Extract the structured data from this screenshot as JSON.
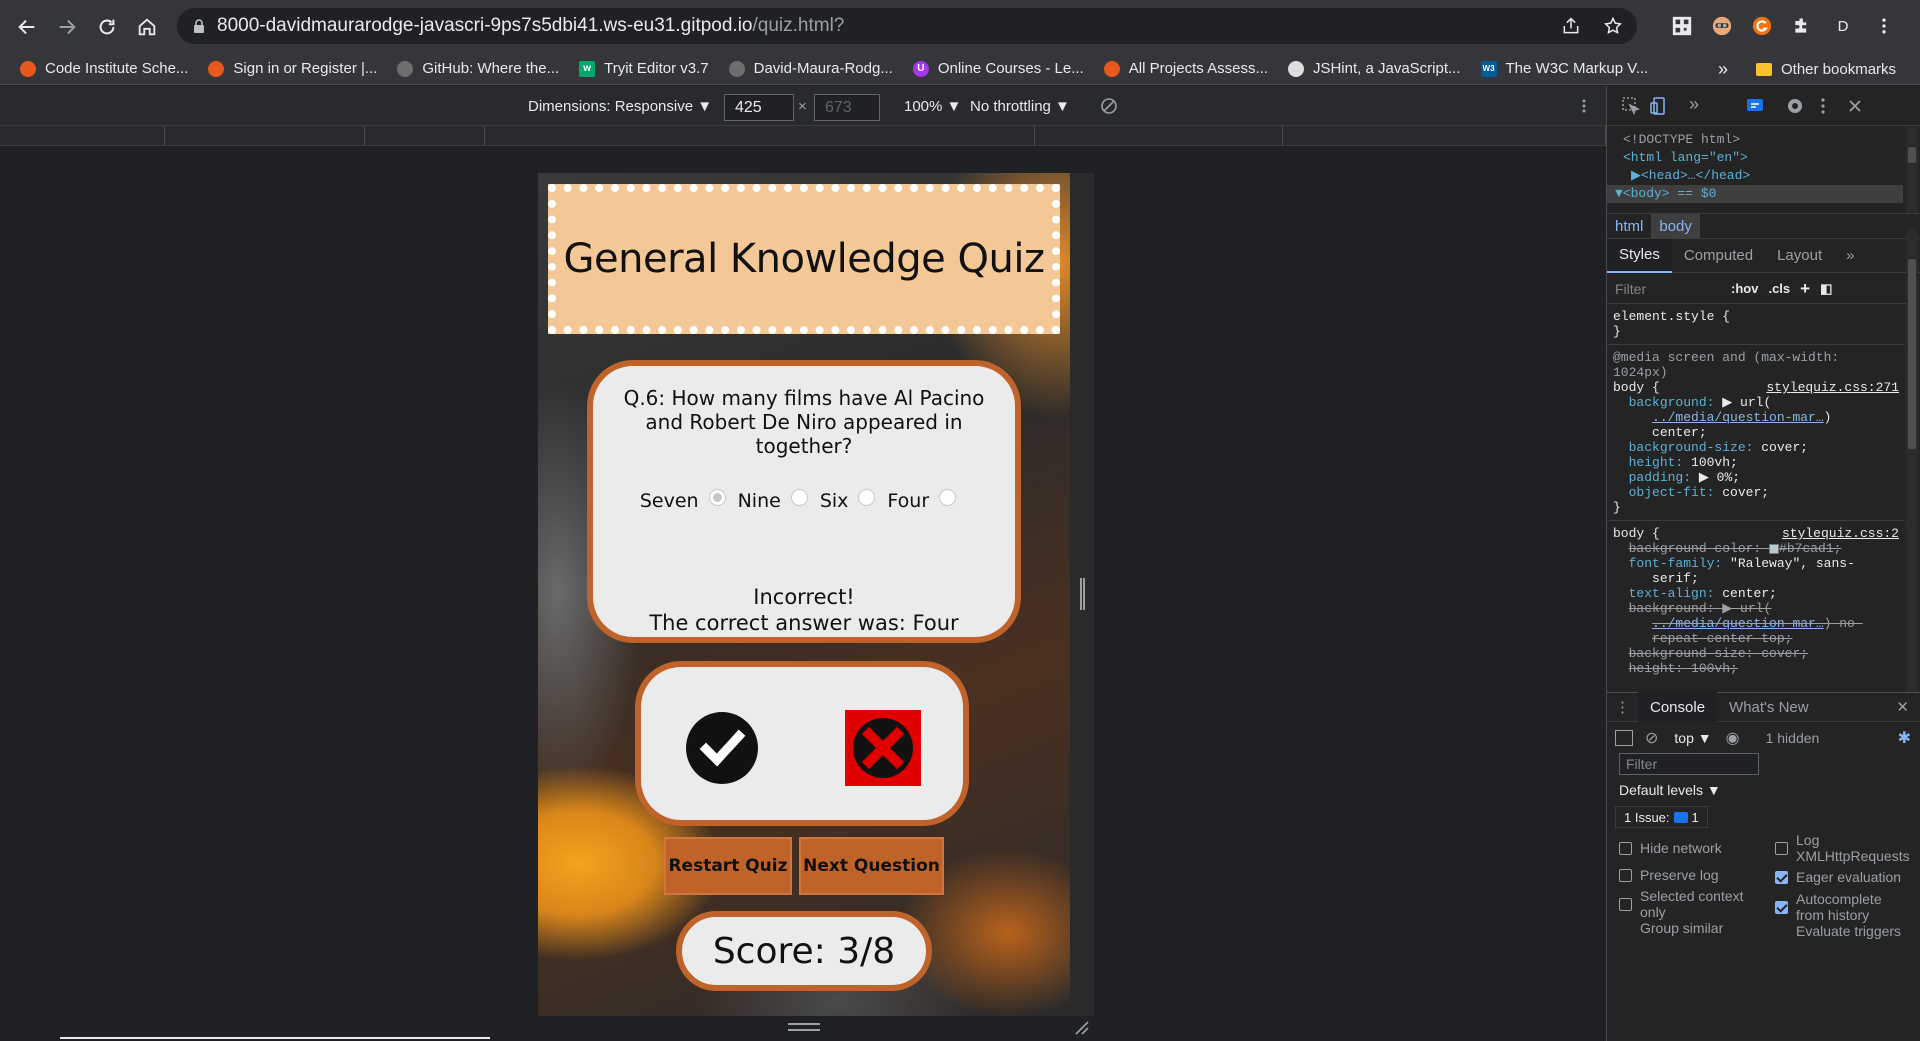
{
  "browser": {
    "url_host": "8000-davidmaurarodge-javascri-9ps7s5dbi41.ws-eu31.gitpod.io",
    "url_path": "/quiz.html?",
    "profile_initial": "D",
    "bookmarks": [
      {
        "label": "Code Institute Sche...",
        "color": "#e8581e",
        "glyph": ""
      },
      {
        "label": "Sign in or Register |...",
        "color": "#e8581e",
        "glyph": ""
      },
      {
        "label": "GitHub: Where the...",
        "color": "#555555",
        "glyph": ""
      },
      {
        "label": "Tryit Editor v3.7",
        "color": "#04aa6d",
        "glyph": "w"
      },
      {
        "label": "David-Maura-Rodg...",
        "color": "#555555",
        "glyph": ""
      },
      {
        "label": "Online Courses - Le...",
        "color": "#a435f0",
        "glyph": "U"
      },
      {
        "label": "All Projects Assess...",
        "color": "#e8581e",
        "glyph": ""
      },
      {
        "label": "JSHint, a JavaScript...",
        "color": "#dddddd",
        "glyph": ""
      },
      {
        "label": "The W3C Markup V...",
        "color": "#005a9c",
        "glyph": "W3"
      }
    ],
    "bookmarks_more": "»",
    "other_bookmarks": "Other bookmarks"
  },
  "device_toolbar": {
    "dimensions": "Dimensions: Responsive ▼",
    "width": "425",
    "times": "×",
    "height": "673",
    "zoom": "100% ▼",
    "throttling": "No throttling ▼"
  },
  "quiz": {
    "title": "General Knowledge Quiz",
    "question": "Q.6: How many films have Al Pacino and Robert De Niro appeared in together?",
    "answers": [
      {
        "label": "Seven",
        "checked": true
      },
      {
        "label": "Nine",
        "checked": false
      },
      {
        "label": "Six",
        "checked": false
      },
      {
        "label": "Four",
        "checked": false
      }
    ],
    "feedback_line1": "Incorrect!",
    "feedback_line2": "The correct answer was: Four",
    "restart_label": "Restart Quiz",
    "next_label": "Next Question",
    "score": "Score: 3/8"
  },
  "devtools": {
    "dom": {
      "doctype": "<!DOCTYPE html>",
      "html_open": "<html lang=\"en\">",
      "head": "▶<head>…</head>",
      "body": "▼<body> == $0"
    },
    "breadcrumbs": [
      "html",
      "body"
    ],
    "tabs": [
      "Styles",
      "Computed",
      "Layout",
      "»"
    ],
    "filter_placeholder": "Filter",
    "hov": ":hov",
    "cls": ".cls",
    "css_rules": {
      "element_style": "element.style {",
      "close": "}",
      "media": "@media screen and (max-width:",
      "media2": "1024px)",
      "body_sel": "body {",
      "link1": "stylequiz.css:271",
      "link2": "stylequiz.css:2",
      "bg": "background:",
      "bg_val": "▶ url(",
      "bg_url": "../media/question-mar…",
      "bg_end": ")",
      "center": "center;",
      "bgsize": "background-size:",
      "bgsize_val": "cover;",
      "height": "height:",
      "height_val": "100vh;",
      "padding": "padding:",
      "padding_val": "▶ 0%;",
      "objfit": "object-fit:",
      "objfit_val": "cover;",
      "bgcolor": "background-color:",
      "bgcolor_val": "#b7cad1;",
      "font": "font-family:",
      "font_val": "\"Raleway\", sans-",
      "font_val2": "serif;",
      "textalign": "text-align:",
      "textalign_val": "center;",
      "bg2": "background:",
      "bg2_val": "▶ url(",
      "bg2_url": "../media/question-mar…",
      "bg2_end": ") no-",
      "bg2_rest": "repeat center top;",
      "bgsize2": "background-size:",
      "bgsize2_val": "cover;",
      "height2": "height:",
      "height2_val": "100vh;"
    },
    "drawer_tabs": [
      "Console",
      "What's New"
    ],
    "console_context": "top ▼",
    "hidden_count": "1 hidden",
    "console_filter": "Filter",
    "default_levels": "Default levels ▼",
    "issues": "1 Issue:",
    "issues_count": "1",
    "settings": {
      "hide_network": "Hide network",
      "preserve_log": "Preserve log",
      "selected_context": "Selected context",
      "only": "only",
      "group_similar": "Group similar",
      "log_xhr_1": "Log",
      "log_xhr_2": "XMLHttpRequests",
      "eager": "Eager evaluation",
      "autocomplete_1": "Autocomplete",
      "autocomplete_2": "from history",
      "evaluate": "Evaluate triggers"
    }
  }
}
